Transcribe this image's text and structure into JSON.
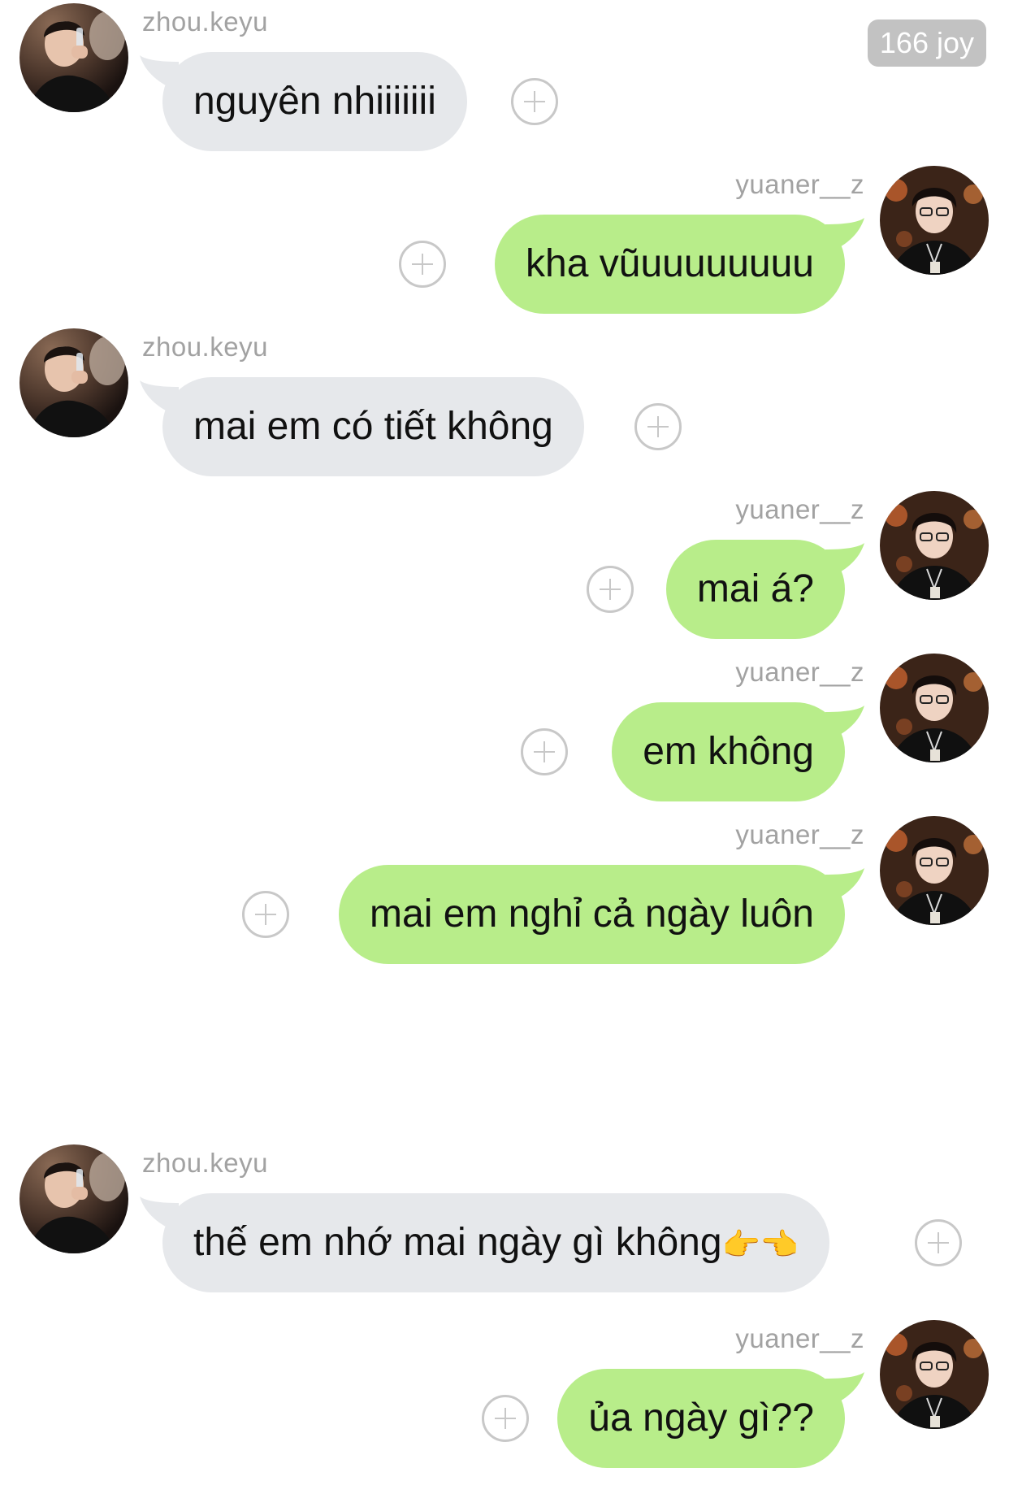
{
  "badge": {
    "text": "166 joy"
  },
  "users": {
    "zhou": {
      "name": "zhou.keyu",
      "avatar_icon": "avatar-zhou-keyu-photo"
    },
    "yuaner": {
      "name": "yuaner__z",
      "avatar_icon": "avatar-yuaner-z-photo"
    }
  },
  "colors": {
    "incoming_bubble": "#e6e8eb",
    "outgoing_bubble": "#b8ed8a",
    "username_text": "#a2a2a2",
    "badge_bg": "#c2c2c2",
    "plus_icon": "#c8c8c8"
  },
  "messages": [
    {
      "sender": "zhou.keyu",
      "side": "left",
      "text": "nguyên nhiiiiiii"
    },
    {
      "sender": "yuaner__z",
      "side": "right",
      "text": "kha vũuuuuuuuu"
    },
    {
      "sender": "zhou.keyu",
      "side": "left",
      "text": "mai em có tiết không"
    },
    {
      "sender": "yuaner__z",
      "side": "right",
      "text": "mai á?"
    },
    {
      "sender": "yuaner__z",
      "side": "right",
      "text": "em không"
    },
    {
      "sender": "yuaner__z",
      "side": "right",
      "text": "mai em nghỉ cả ngày luôn"
    },
    {
      "sender": "zhou.keyu",
      "side": "left",
      "text": "thế em nhớ mai ngày gì không",
      "trailing_emoji": [
        "👉",
        "👈"
      ]
    },
    {
      "sender": "yuaner__z",
      "side": "right",
      "text": "ủa ngày gì??"
    }
  ]
}
